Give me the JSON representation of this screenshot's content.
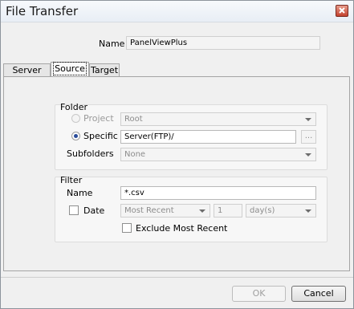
{
  "window": {
    "title": "File Transfer"
  },
  "name": {
    "label": "Name",
    "value": "PanelViewPlus"
  },
  "tabs": [
    {
      "label": "Server"
    },
    {
      "label": "Source"
    },
    {
      "label": "Target"
    }
  ],
  "folder": {
    "heading": "Folder",
    "project_label": "Project",
    "project_value": "Root",
    "specific_label": "Specific",
    "specific_value": "Server(FTP)/",
    "browse_label": "...",
    "subfolders_label": "Subfolders",
    "subfolders_value": "None"
  },
  "filter": {
    "heading": "Filter",
    "name_label": "Name",
    "name_value": "*.csv",
    "date_label": "Date",
    "date_mode": "Most Recent",
    "date_count": "1",
    "date_unit": "day(s)",
    "exclude_label": "Exclude Most Recent"
  },
  "buttons": {
    "ok": "OK",
    "cancel": "Cancel"
  }
}
